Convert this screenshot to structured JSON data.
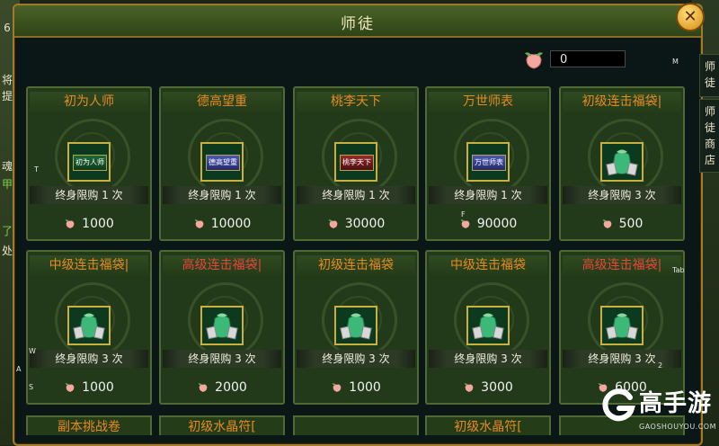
{
  "window": {
    "title": "师徒",
    "close_label": "✕"
  },
  "currency": {
    "icon": "peach-icon",
    "value": "0"
  },
  "hints": {
    "m": "M",
    "t": "T",
    "f": "F",
    "tab": "Tab",
    "w": "W",
    "a": "A",
    "s": "S",
    "two": "2"
  },
  "side_tabs": [
    "师徒",
    "师徒商店"
  ],
  "left_fragments": [
    "6",
    "将",
    "提",
    "魂",
    "甲",
    "了",
    "处"
  ],
  "cards": [
    {
      "title": "初为人师",
      "title_color": "orange",
      "item": "title-badge",
      "item_text": "初为人师",
      "item_style": "green",
      "limit": "终身限购 1 次",
      "price": "1000"
    },
    {
      "title": "德高望重",
      "title_color": "orange",
      "item": "title-badge",
      "item_text": "德高望重",
      "item_style": "blue",
      "limit": "终身限购 1 次",
      "price": "10000"
    },
    {
      "title": "桃李天下",
      "title_color": "orange",
      "item": "title-badge",
      "item_text": "桃李天下",
      "item_style": "red",
      "limit": "终身限购 1 次",
      "price": "30000"
    },
    {
      "title": "万世师表",
      "title_color": "orange",
      "item": "title-badge",
      "item_text": "万世师表",
      "item_style": "blue",
      "limit": "终身限购 1 次",
      "price": "90000"
    },
    {
      "title": "初级连击福袋|",
      "title_color": "orange",
      "item": "lucky-bag",
      "limit": "终身限购 3 次",
      "price": "500"
    },
    {
      "title": "中级连击福袋|",
      "title_color": "orange",
      "item": "lucky-bag",
      "limit": "终身限购 3 次",
      "price": "1000"
    },
    {
      "title": "高级连击福袋|",
      "title_color": "red",
      "item": "lucky-bag",
      "limit": "终身限购 3 次",
      "price": "2000"
    },
    {
      "title": "初级连击福袋",
      "title_color": "orange",
      "item": "lucky-bag",
      "limit": "终身限购 3 次",
      "price": "1000"
    },
    {
      "title": "中级连击福袋",
      "title_color": "orange",
      "item": "lucky-bag",
      "limit": "终身限购 3 次",
      "price": "3000"
    },
    {
      "title": "高级连击福袋|",
      "title_color": "red",
      "item": "lucky-bag",
      "limit": "终身限购 3 次",
      "price": "6000"
    }
  ],
  "partial_titles": [
    "副本挑战卷",
    "初级水晶符[",
    "",
    "初级水晶符[",
    ""
  ],
  "watermark": {
    "brand": "高手游",
    "url": "GAOSHOUYOU.COM"
  },
  "colors": {
    "orange_title": "#e68a24",
    "red_title": "#e8463a",
    "gold_border": "#a07b2c"
  }
}
